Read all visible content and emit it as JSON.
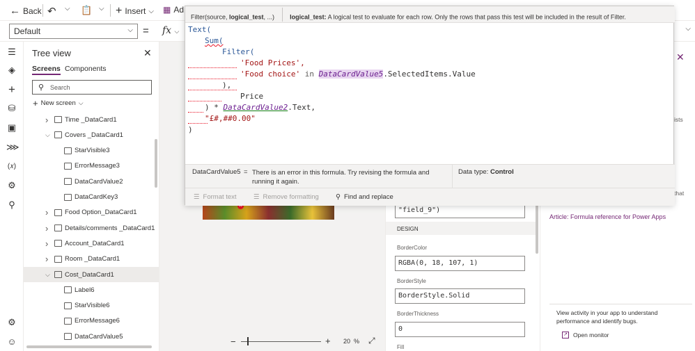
{
  "toolbar": {
    "back_label": "Back",
    "insert_label": "Insert",
    "add_label": "Ad"
  },
  "formula_bar": {
    "property": "Default",
    "equals": "=",
    "fx": "fx"
  },
  "popup": {
    "signature_prefix": "Filter(source, ",
    "signature_param": "logical_test",
    "signature_suffix": ", ...)",
    "param_name": "logical_test:",
    "param_desc": "A logical test to evaluate for each row. Only the rows that pass this test will be included in the result of Filter.",
    "code": {
      "l1": "Text(",
      "l2": "Sum(",
      "l3": "Filter(",
      "l4": "'Food Prices',",
      "l5a": "'Food choice' ",
      "l5in": "in ",
      "l5ctl": "DataCardValue5",
      "l5b": ".SelectedItems.Value",
      "l6": "),",
      "l7": "Price",
      "l8a": ") * ",
      "l8ctl": "DataCardValue2",
      "l8b": ".Text,",
      "l9": "\"£#,##0.00\"",
      "l10": ")"
    },
    "error_name": "DataCardValue5",
    "error_eq": "=",
    "error_text": "There is an error in this formula. Try revising the formula and running it again.",
    "data_type_label": "Data type:",
    "data_type_value": "Control",
    "format_text": "Format text",
    "remove_formatting": "Remove formatting",
    "find_replace": "Find and replace"
  },
  "tree": {
    "title": "Tree view",
    "tab_screens": "Screens",
    "tab_components": "Components",
    "search_placeholder": "Search",
    "new_screen": "New screen",
    "items": [
      {
        "label": "Time _DataCard1",
        "level": 1,
        "kind": "card",
        "expanded": false
      },
      {
        "label": "Covers _DataCard1",
        "level": 1,
        "kind": "card",
        "expanded": true
      },
      {
        "label": "StarVisible3",
        "level": 2,
        "kind": "label"
      },
      {
        "label": "ErrorMessage3",
        "level": 2,
        "kind": "label"
      },
      {
        "label": "DataCardValue2",
        "level": 2,
        "kind": "input"
      },
      {
        "label": "DataCardKey3",
        "level": 2,
        "kind": "label"
      },
      {
        "label": "Food Option_DataCard1",
        "level": 1,
        "kind": "card",
        "expanded": false
      },
      {
        "label": "Details/comments _DataCard1",
        "level": 1,
        "kind": "card",
        "expanded": false
      },
      {
        "label": "Account_DataCard1",
        "level": 1,
        "kind": "card",
        "expanded": false
      },
      {
        "label": "Room _DataCard1",
        "level": 1,
        "kind": "card",
        "expanded": false
      },
      {
        "label": "Cost_DataCard1",
        "level": 1,
        "kind": "card",
        "expanded": true,
        "selected": true
      },
      {
        "label": "Label6",
        "level": 2,
        "kind": "label"
      },
      {
        "label": "StarVisible6",
        "level": 2,
        "kind": "label"
      },
      {
        "label": "ErrorMessage6",
        "level": 2,
        "kind": "label"
      },
      {
        "label": "DataCardValue5",
        "level": 2,
        "kind": "input"
      }
    ]
  },
  "canvas": {
    "zoom_minus": "−",
    "zoom_plus": "+",
    "zoom_value": "20",
    "zoom_unit": "%"
  },
  "properties": {
    "field_value": "\"field_9\")",
    "section": "DESIGN",
    "border_color_label": "BorderColor",
    "border_color_value": "RGBA(0, 18, 107, 1)",
    "border_style_label": "BorderStyle",
    "border_style_value": "BorderStyle.Solid",
    "border_thickness_label": "BorderThickness",
    "border_thickness_value": "0",
    "fill_label": "Fill"
  },
  "right_panel": {
    "partial_1": "ists",
    "partial_2": "that",
    "article_link": "Article: Formula reference for Power Apps",
    "monitor_text": "View activity in your app to understand performance and identify bugs.",
    "open_monitor": "Open monitor"
  },
  "colors": {
    "accent": "#742774",
    "link": "#742774",
    "error": "#e81123"
  }
}
